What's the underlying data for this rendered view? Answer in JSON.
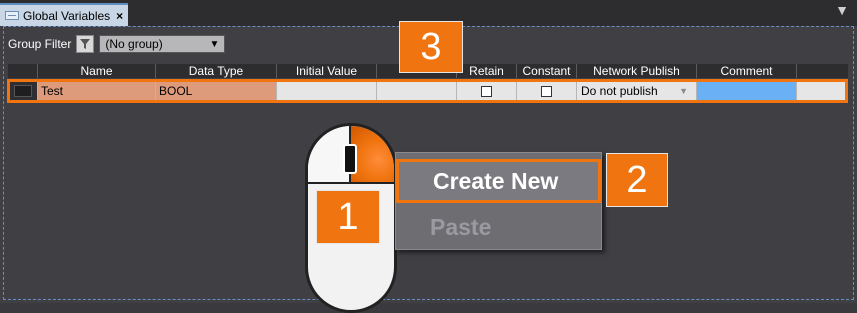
{
  "tab": {
    "label": "Global Variables",
    "close": "×"
  },
  "window_close": "▼",
  "filter": {
    "label": "Group Filter",
    "value": "(No group)"
  },
  "columns": [
    "Name",
    "Data Type",
    "Initial Value",
    "",
    "Retain",
    "Constant",
    "Network Publish",
    "Comment"
  ],
  "row": {
    "name": "Test",
    "data_type": "BOOL",
    "network_publish": "Do not publish"
  },
  "context_menu": {
    "create_new": "Create New",
    "paste": "Paste"
  },
  "callouts": {
    "one": "1",
    "two": "2",
    "three": "3"
  },
  "colors": {
    "accent": "#f0740f",
    "selection": "#dd9b7c",
    "comment_cell": "#6ab0f5"
  }
}
